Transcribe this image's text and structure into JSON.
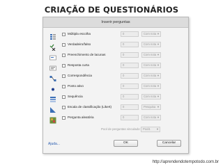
{
  "slide": {
    "title": "CRIAÇÃO DE QUESTIONÁRIOS",
    "footer": "http://aprendendotempotodo.com.br"
  },
  "dialog": {
    "title": "Inserir perguntas",
    "question_types": [
      {
        "label": "Múltipla escolha",
        "icon": "multiple-choice-icon",
        "count": "0",
        "grading": "Com nota"
      },
      {
        "label": "Verdadeiro/falso",
        "icon": "true-false-icon",
        "count": "0",
        "grading": "Com nota"
      },
      {
        "label": "Preenchimento de lacunas",
        "icon": "fill-in-blank-icon",
        "count": "0",
        "grading": "Com nota"
      },
      {
        "label": "Resposta curta",
        "icon": "short-answer-icon",
        "count": "0",
        "grading": "Com nota"
      },
      {
        "label": "Correspondência",
        "icon": "matching-icon",
        "count": "0",
        "grading": "Com nota"
      },
      {
        "label": "Ponto ativo",
        "icon": "hotspot-icon",
        "count": "0",
        "grading": "Com nota"
      },
      {
        "label": "Sequência",
        "icon": "sequence-icon",
        "count": "0",
        "grading": "Com nota"
      },
      {
        "label": "Escala de classificação (Likert)",
        "icon": "likert-scale-icon",
        "count": "0",
        "grading": "Pesquisa"
      },
      {
        "label": "Pergunta aleatória",
        "icon": "random-question-icon",
        "count": "0",
        "grading": "Com nota"
      }
    ],
    "pool_label": "Pool de perguntas vinculado:",
    "pool_value": "Pool1",
    "help_label": "Ajuda...",
    "ok_label": "OK",
    "cancel_label": "Cancelar"
  }
}
